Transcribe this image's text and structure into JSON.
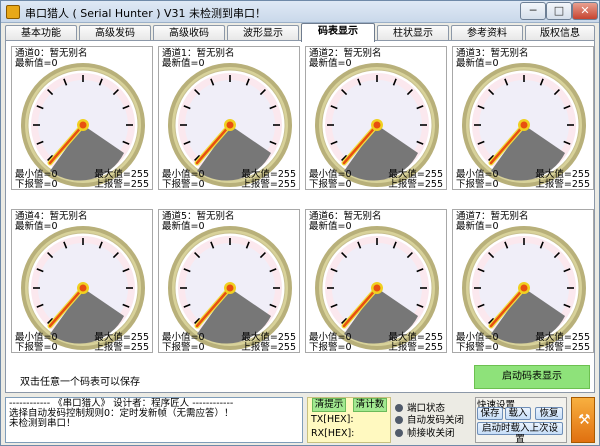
{
  "window": {
    "title": "串口猎人 ( Serial Hunter ) V31    未检测到串口！",
    "min_label": "─",
    "max_label": "□",
    "close_label": "✕"
  },
  "tabs": [
    {
      "label": "基本功能"
    },
    {
      "label": "高级发码"
    },
    {
      "label": "高级收码"
    },
    {
      "label": "波形显示"
    },
    {
      "label": "码表显示",
      "active": true
    },
    {
      "label": "柱状显示"
    },
    {
      "label": "参考资料"
    },
    {
      "label": "版权信息"
    }
  ],
  "meters": [
    {
      "name": "通道0：暂无别名",
      "latest": "最新值=0",
      "min": "最小值=0",
      "low": "下报警=0",
      "max": "最大值=255",
      "high": "上报警=255"
    },
    {
      "name": "通道1：暂无别名",
      "latest": "最新值=0",
      "min": "最小值=0",
      "low": "下报警=0",
      "max": "最大值=255",
      "high": "上报警=255"
    },
    {
      "name": "通道2：暂无别名",
      "latest": "最新值=0",
      "min": "最小值=0",
      "low": "下报警=0",
      "max": "最大值=255",
      "high": "上报警=255"
    },
    {
      "name": "通道3：暂无别名",
      "latest": "最新值=0",
      "min": "最小值=0",
      "low": "下报警=0",
      "max": "最大值=255",
      "high": "上报警=255"
    },
    {
      "name": "通道4：暂无别名",
      "latest": "最新值=0",
      "min": "最小值=0",
      "low": "下报警=0",
      "max": "最大值=255",
      "high": "上报警=255"
    },
    {
      "name": "通道5：暂无别名",
      "latest": "最新值=0",
      "min": "最小值=0",
      "low": "下报警=0",
      "max": "最大值=255",
      "high": "上报警=255"
    },
    {
      "name": "通道6：暂无别名",
      "latest": "最新值=0",
      "min": "最小值=0",
      "low": "下报警=0",
      "max": "最大值=255",
      "high": "上报警=255"
    },
    {
      "name": "通道7：暂无别名",
      "latest": "最新值=0",
      "min": "最小值=0",
      "low": "下报警=0",
      "max": "最大值=255",
      "high": "上报警=255"
    }
  ],
  "panel": {
    "hint": "双击任意一个码表可以保存",
    "start_button": "启动码表显示"
  },
  "log": {
    "lines": [
      "------------ 《串口猎人》 设计者：程序匠人 ------------",
      "选择自动发码控制规则0：定时发新帧（无需应答）！",
      "未检测到串口！"
    ]
  },
  "counters": {
    "clear_hint": "清提示",
    "clear_count": "清计数",
    "tx_label": "TX[HEX]:",
    "rx_label": "RX[HEX]:"
  },
  "status": {
    "port": "端口状态",
    "auto_send": "自动发码关闭",
    "frame_recv": "帧接收关闭"
  },
  "quick": {
    "title": "快速设置",
    "save": "保存",
    "load": "载入",
    "restore": "恢复",
    "autoload": "启动时载入上次设置"
  },
  "colors": {
    "gauge_bezel": "#b8b07a",
    "gauge_face": "#f0eef8",
    "needle": "#e85010",
    "start_button": "#8ee27a"
  }
}
